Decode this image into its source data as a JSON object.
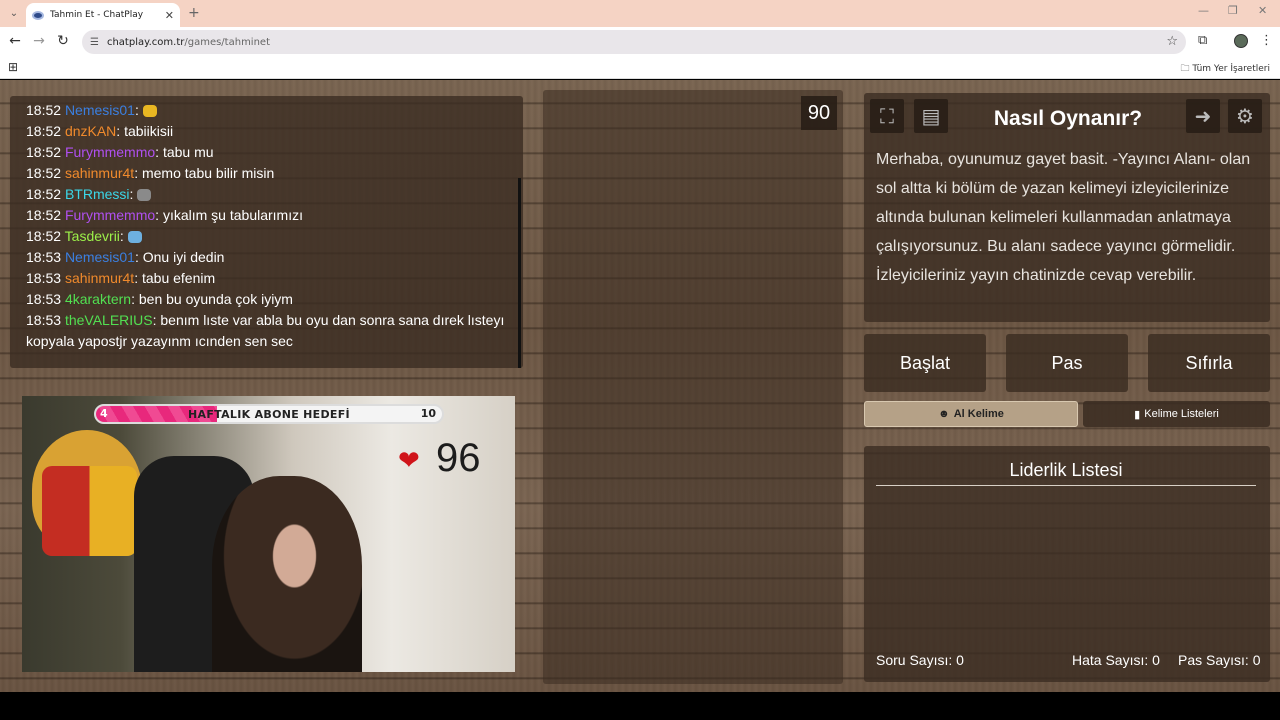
{
  "browser": {
    "tab_title": "Tahmin Et - ChatPlay",
    "new_tab": "+",
    "url_host": "chatplay.com.tr",
    "url_path": "/games/tahminet",
    "bookmark_folder": "Tüm Yer İşaretleri"
  },
  "chat": {
    "messages": [
      {
        "time": "18:52",
        "user": "Nemesis01",
        "color": "#3b7fe0",
        "text": "",
        "emote": "#e9b722"
      },
      {
        "time": "18:52",
        "user": "dnzKAN",
        "color": "#f08a2c",
        "text": " tabiikisii"
      },
      {
        "time": "18:52",
        "user": "Furymmemmo",
        "color": "#b050f0",
        "text": " tabu mu"
      },
      {
        "time": "18:52",
        "user": "sahinmur4t",
        "color": "#f08a2c",
        "text": " memo tabu bilir misin"
      },
      {
        "time": "18:52",
        "user": "BTRmessi",
        "color": "#3bd7e8",
        "text": "",
        "emote": "#8a8a8a"
      },
      {
        "time": "18:52",
        "user": "Furymmemmo",
        "color": "#b050f0",
        "text": " yıkalım şu tabularımızı"
      },
      {
        "time": "18:52",
        "user": "Tasdevrii",
        "color": "#9cf04a",
        "text": "",
        "emote": "#6db0e0"
      },
      {
        "time": "18:53",
        "user": "Nemesis01",
        "color": "#3b7fe0",
        "text": " Onu iyi dedin"
      },
      {
        "time": "18:53",
        "user": "sahinmur4t",
        "color": "#f08a2c",
        "text": " tabu efenim"
      },
      {
        "time": "18:53",
        "user": "4karaktern",
        "color": "#52e052",
        "text": " ben bu oyunda çok iyiym"
      },
      {
        "time": "18:53",
        "user": "theVALERIUS",
        "color": "#52e052",
        "text": " benım lıste var abla bu oyu dan sonra sana dırek lısteyı kopyala yapostjr yazayınm ıcınden sen sec"
      }
    ]
  },
  "stream": {
    "goal_start": "4",
    "goal_label": "HAFTALIK ABONE HEDEFİ",
    "goal_end": "10",
    "goal_progress": 0.35,
    "viewers": "96"
  },
  "game": {
    "timer": "90",
    "howto_title": "Nasıl Oynanır?",
    "howto_text": "Merhaba, oyunumuz gayet basit. -Yayıncı Alanı- olan sol altta ki bölüm de yazan kelimeyi izleyicilerinize altında bulunan kelimeleri kullanmadan anlatmaya çalışıyorsunuz. Bu alanı sadece yayıncı görmelidir. İzleyicileriniz yayın chatinizde cevap verebilir.",
    "start_label": "Başlat",
    "pass_label": "Pas",
    "reset_label": "Sıfırla",
    "get_word_label": "Al Kelime",
    "word_lists_label": "Kelime Listeleri",
    "leaderboard_title": "Liderlik Listesi",
    "question_count": "Soru Sayısı: 0",
    "error_count": "Hata Sayısı: 0",
    "pass_count": "Pas Sayısı: 0"
  },
  "colors": {
    "accent_pink": "#e8287c",
    "heart": "#d0141a"
  }
}
